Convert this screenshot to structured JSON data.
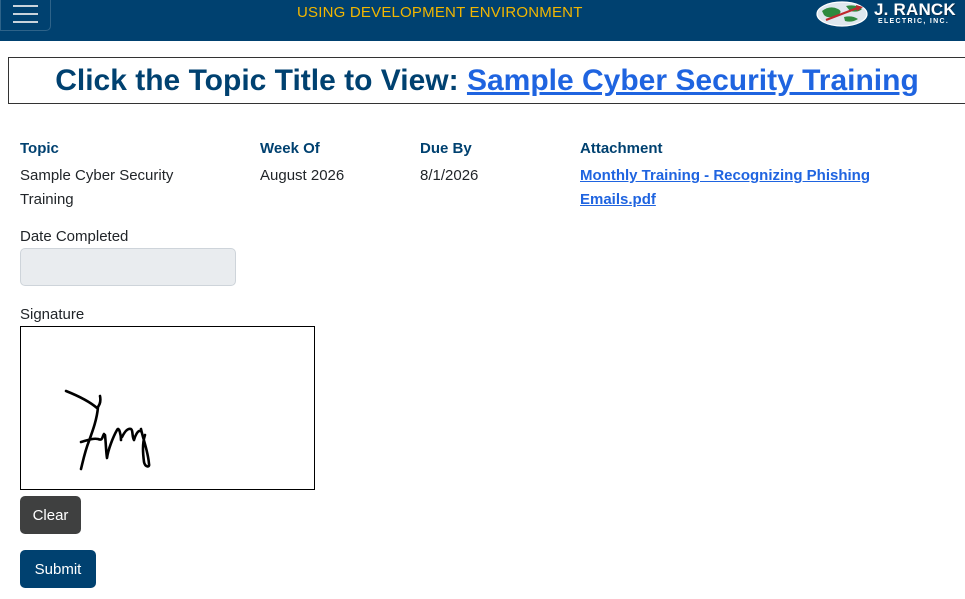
{
  "header": {
    "environment_banner": "USING DEVELOPMENT ENVIRONMENT",
    "logo": {
      "name": "J. RANCK",
      "subtitle": "ELECTRIC, INC."
    },
    "menu_icon": "hamburger-icon",
    "bar_color": "#004170",
    "banner_color": "#f2b600"
  },
  "title": {
    "prefix": "Click the Topic Title to View: ",
    "link_text": "Sample Cyber Security Training"
  },
  "details": {
    "topic_label": "Topic",
    "topic_value": "Sample Cyber Security Training",
    "week_label": "Week Of",
    "week_value": "August 2026",
    "due_label": "Due By",
    "due_value": "8/1/2026",
    "attachment_label": "Attachment",
    "attachment_value": "Monthly Training - Recognizing Phishing Emails.pdf"
  },
  "form": {
    "date_completed_label": "Date Completed",
    "date_completed_value": "",
    "signature_label": "Signature",
    "clear_label": "Clear",
    "submit_label": "Submit"
  }
}
